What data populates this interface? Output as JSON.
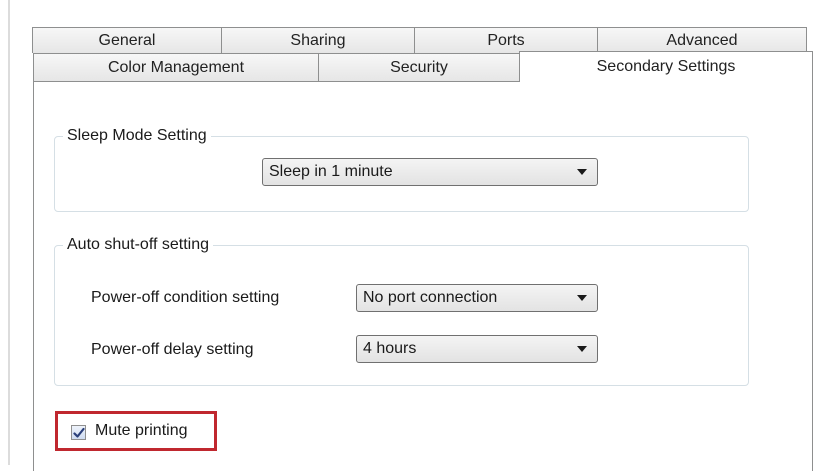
{
  "tabs": {
    "row1": [
      "General",
      "Sharing",
      "Ports",
      "Advanced"
    ],
    "row2": [
      "Color Management",
      "Security",
      "Secondary Settings"
    ],
    "active": "Secondary Settings"
  },
  "sleep_mode": {
    "group_label": "Sleep Mode Setting",
    "value": "Sleep in 1 minute"
  },
  "auto_shutoff": {
    "group_label": "Auto shut-off setting",
    "condition_label": "Power-off condition setting",
    "condition_value": "No port connection",
    "delay_label": "Power-off delay setting",
    "delay_value": "4 hours"
  },
  "mute_printing": {
    "label": "Mute printing",
    "checked": true
  },
  "colors": {
    "highlight": "#c0282f",
    "tab_border": "#8e8f8f",
    "group_border": "#d5dfe5"
  },
  "icons": {
    "checkmark": "checkmark-icon",
    "dropdown": "chevron-down-icon"
  }
}
